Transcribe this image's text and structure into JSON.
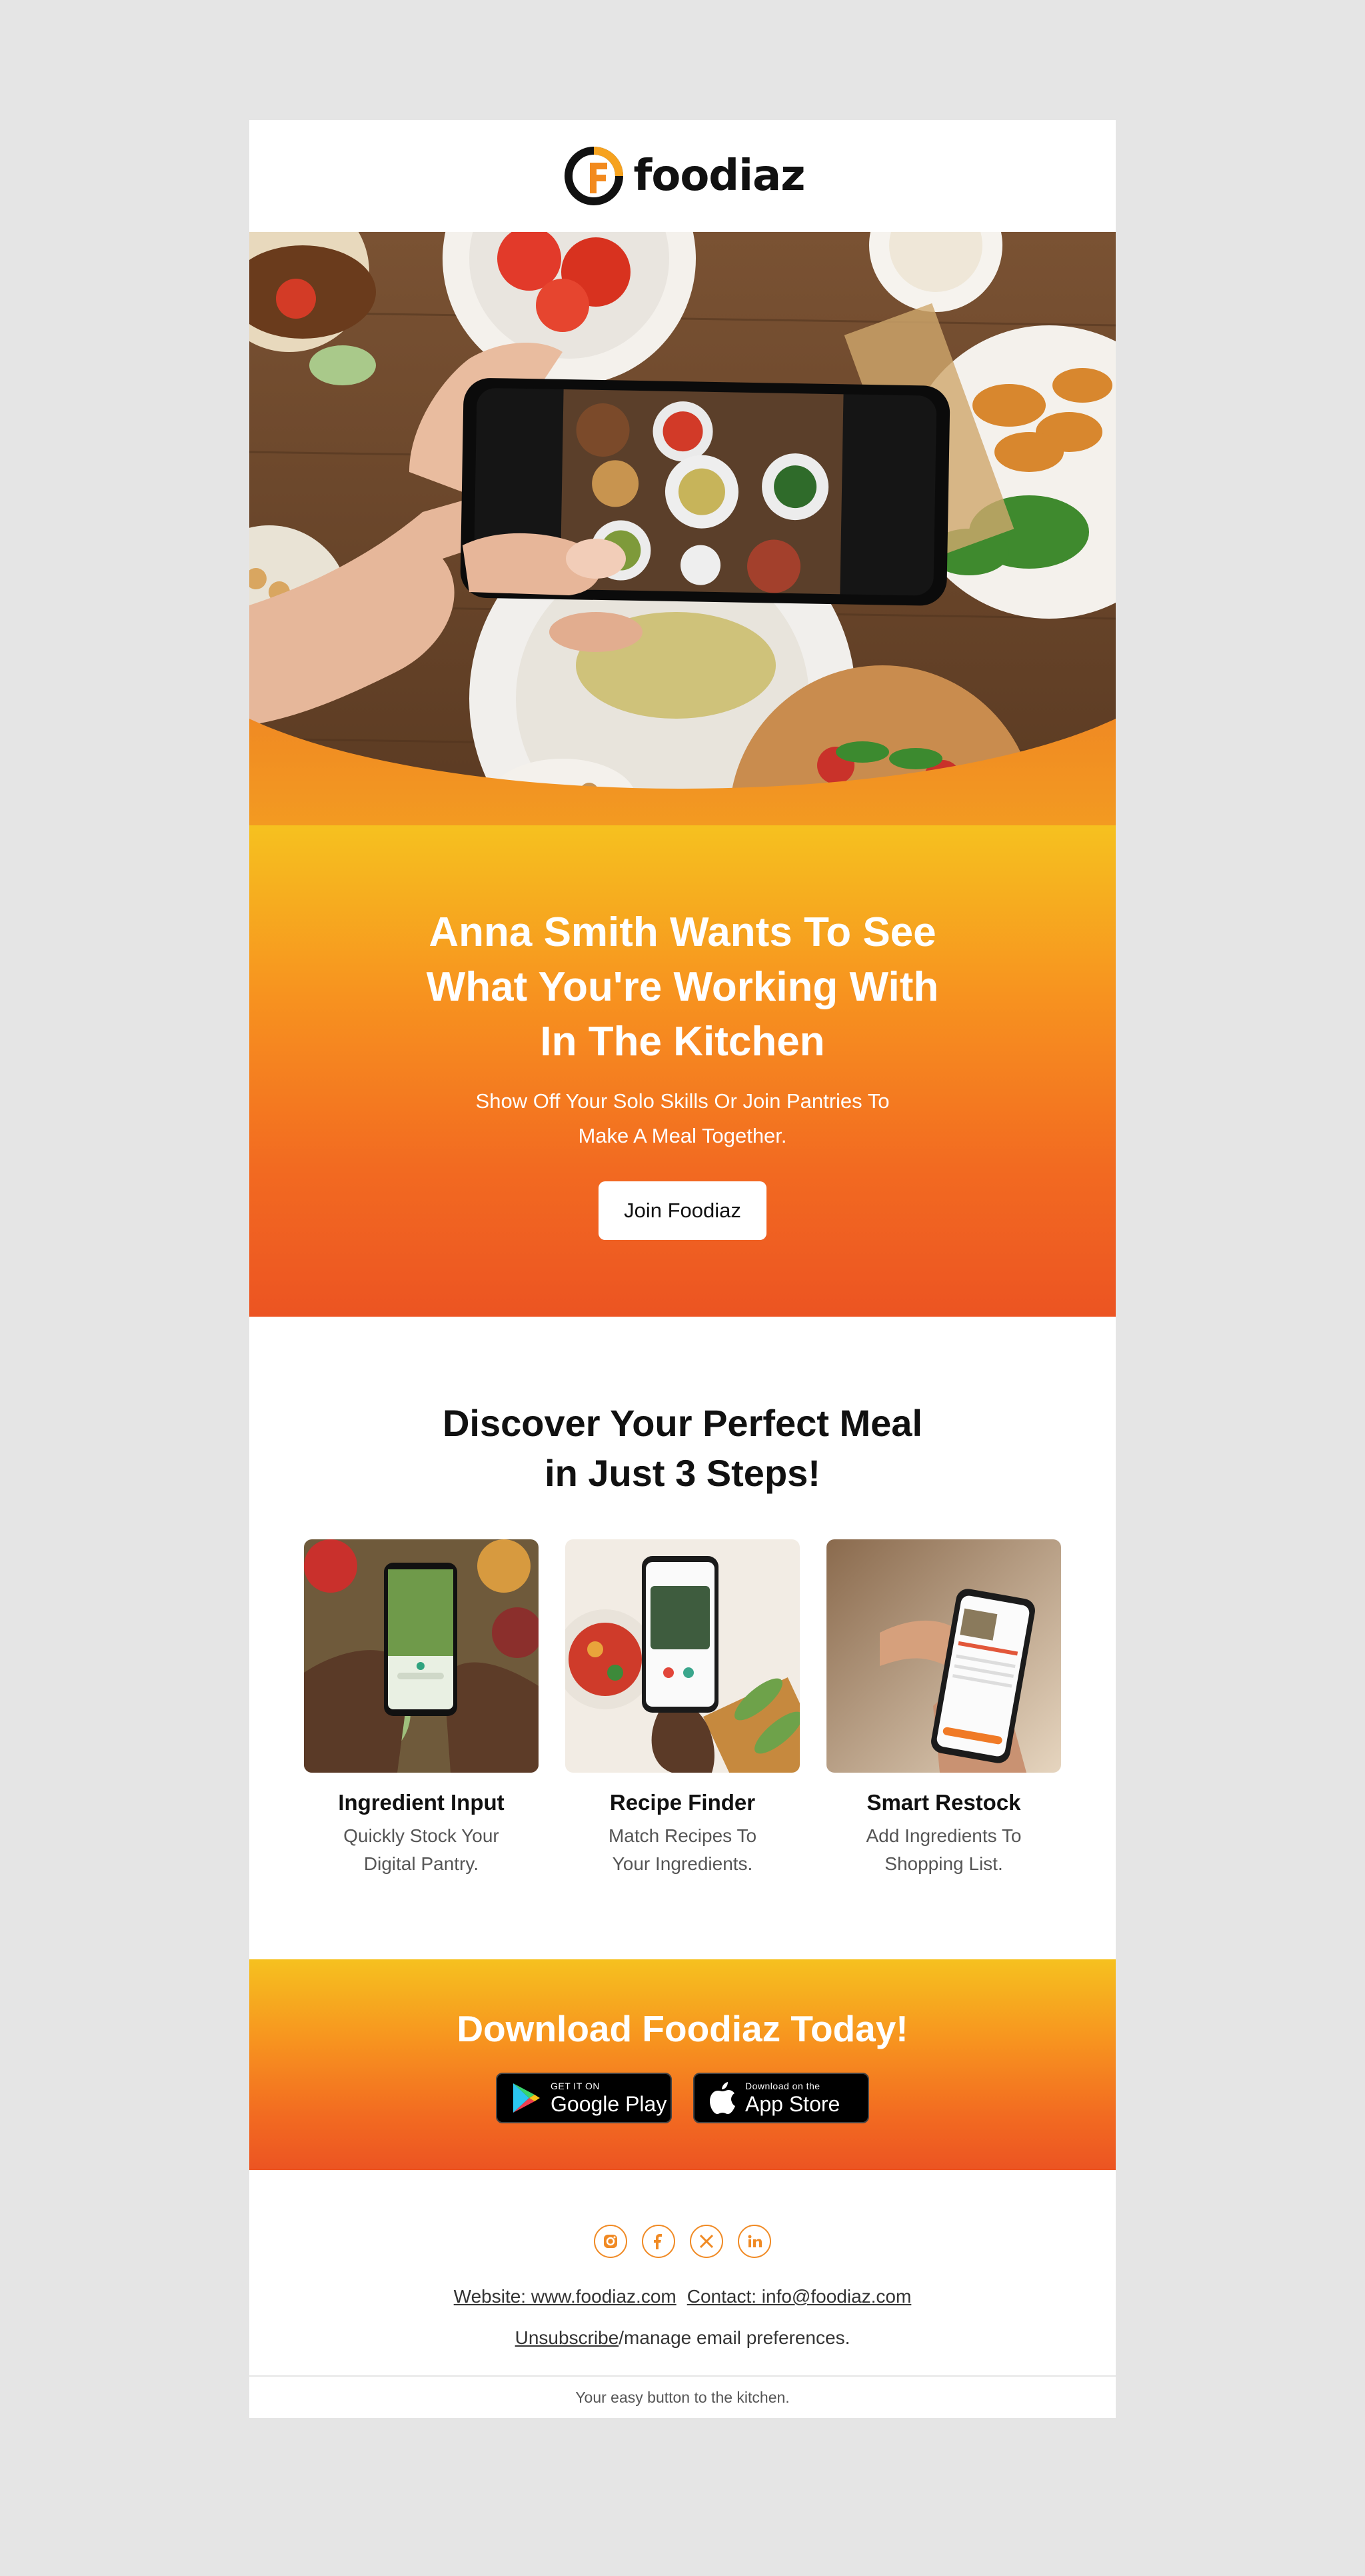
{
  "brand": {
    "name": "foodiaz"
  },
  "hero": {
    "alt": ""
  },
  "intro": {
    "title": "Anna Smith Wants To See What You're Working With In The Kitchen",
    "subtitle": "Show Off Your Solo Skills Or Join Pantries To Make A Meal Together.",
    "cta_label": "Join Foodiaz"
  },
  "steps": {
    "heading_line1": "Discover Your Perfect Meal",
    "heading_line2": "in Just 3 Steps!",
    "cards": [
      {
        "title": "Ingredient Input",
        "desc": "Quickly Stock Your Digital Pantry."
      },
      {
        "title": "Recipe Finder",
        "desc": "Match Recipes To Your Ingredients."
      },
      {
        "title": "Smart Restock",
        "desc": "Add Ingredients To Shopping List."
      }
    ]
  },
  "download": {
    "heading": "Download Foodiaz Today!",
    "google": {
      "small": "GET IT ON",
      "big": "Google Play"
    },
    "apple": {
      "small": "Download on the",
      "big": "App Store"
    }
  },
  "footer": {
    "socials": [
      "instagram-icon",
      "facebook-icon",
      "x-icon",
      "linkedin-icon"
    ],
    "website": "Website: www.foodiaz.com",
    "contact": "Contact: info@foodiaz.com",
    "unsubscribe": "Unsubscribe",
    "manage_rest": "/manage email preferences.",
    "tagline": "Your easy button to the kitchen."
  },
  "colors": {
    "accent_orange": "#f26a21",
    "accent_yellow": "#f6c11f",
    "icon_orange": "#f08a24"
  }
}
